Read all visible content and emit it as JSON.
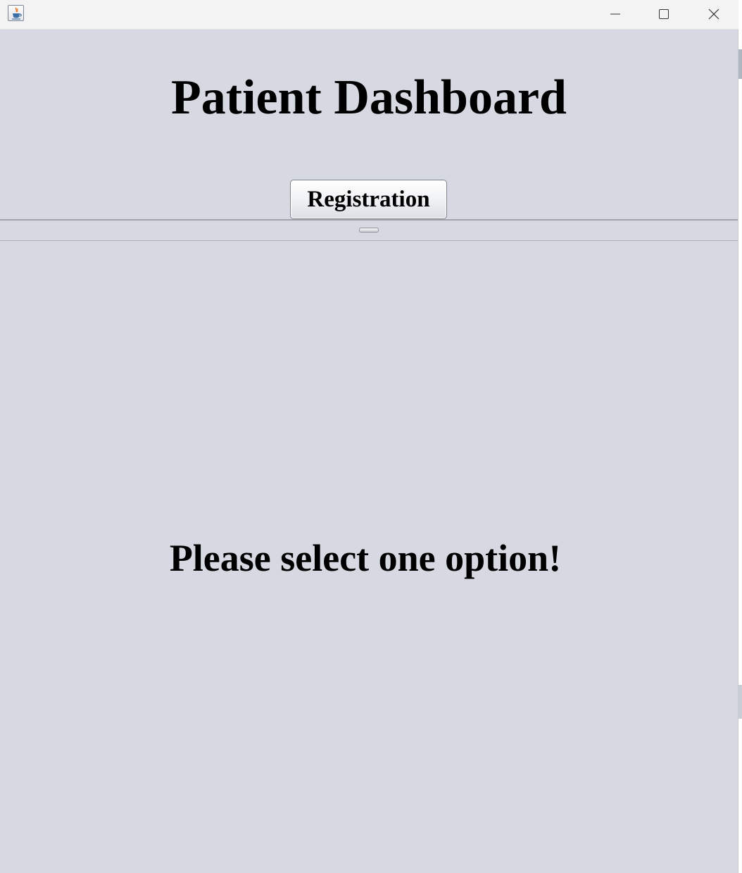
{
  "window": {
    "title": "",
    "controls": {
      "minimize": "minimize-icon",
      "maximize": "maximize-icon",
      "close": "close-icon"
    }
  },
  "dashboard": {
    "title": "Patient Dashboard",
    "registration_label": "Registration"
  },
  "content": {
    "message": "Please select one option!"
  },
  "colors": {
    "panel_background": "#d6d9e1",
    "titlebar_background": "#f3f3f3",
    "text": "#000000"
  }
}
